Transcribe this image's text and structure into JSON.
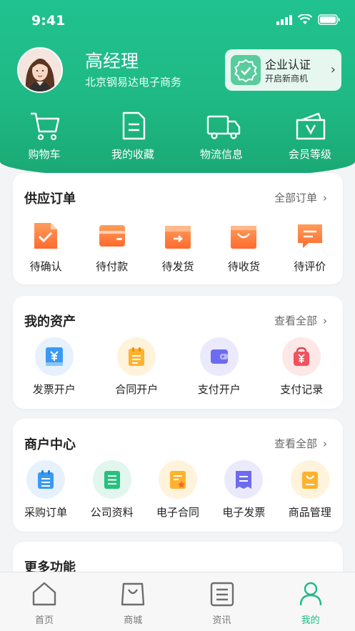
{
  "status_bar": {
    "time": "9:41"
  },
  "profile": {
    "name": "高经理",
    "company": "北京钢易达电子商务"
  },
  "certification": {
    "title": "企业认证",
    "subtitle": "开启新商机"
  },
  "quick_actions": [
    {
      "label": "购物车",
      "icon": "cart-icon"
    },
    {
      "label": "我的收藏",
      "icon": "document-icon"
    },
    {
      "label": "物流信息",
      "icon": "truck-icon"
    },
    {
      "label": "会员等级",
      "icon": "vip-box-icon"
    }
  ],
  "supply_orders": {
    "title": "供应订单",
    "link": "全部订单",
    "items": [
      {
        "label": "待确认",
        "icon": "confirm-icon"
      },
      {
        "label": "待付款",
        "icon": "wallet-icon"
      },
      {
        "label": "待发货",
        "icon": "ship-box-icon"
      },
      {
        "label": "待收货",
        "icon": "receive-bag-icon"
      },
      {
        "label": "待评价",
        "icon": "comment-icon"
      }
    ]
  },
  "assets": {
    "title": "我的资产",
    "link": "查看全部",
    "items": [
      {
        "label": "发票开户",
        "icon": "invoice-yen-icon"
      },
      {
        "label": "合同开户",
        "icon": "contract-icon"
      },
      {
        "label": "支付开户",
        "icon": "payment-wallet-icon"
      },
      {
        "label": "支付记录",
        "icon": "payment-record-icon"
      }
    ]
  },
  "merchant_center": {
    "title": "商户中心",
    "link": "查看全部",
    "items": [
      {
        "label": "采购订单",
        "icon": "purchase-order-icon"
      },
      {
        "label": "公司资料",
        "icon": "company-info-icon"
      },
      {
        "label": "电子合同",
        "icon": "e-contract-icon"
      },
      {
        "label": "电子发票",
        "icon": "e-invoice-icon"
      },
      {
        "label": "商品管理",
        "icon": "goods-management-icon"
      }
    ]
  },
  "more": {
    "title": "更多功能"
  },
  "tabbar": [
    {
      "label": "首页",
      "icon": "home-icon"
    },
    {
      "label": "商城",
      "icon": "shopping-bag-icon"
    },
    {
      "label": "资讯",
      "icon": "news-icon"
    },
    {
      "label": "我的",
      "icon": "profile-icon",
      "active": true
    }
  ],
  "colors": {
    "brand": "#1fb985",
    "accent_orange": "#ff7a3d"
  }
}
